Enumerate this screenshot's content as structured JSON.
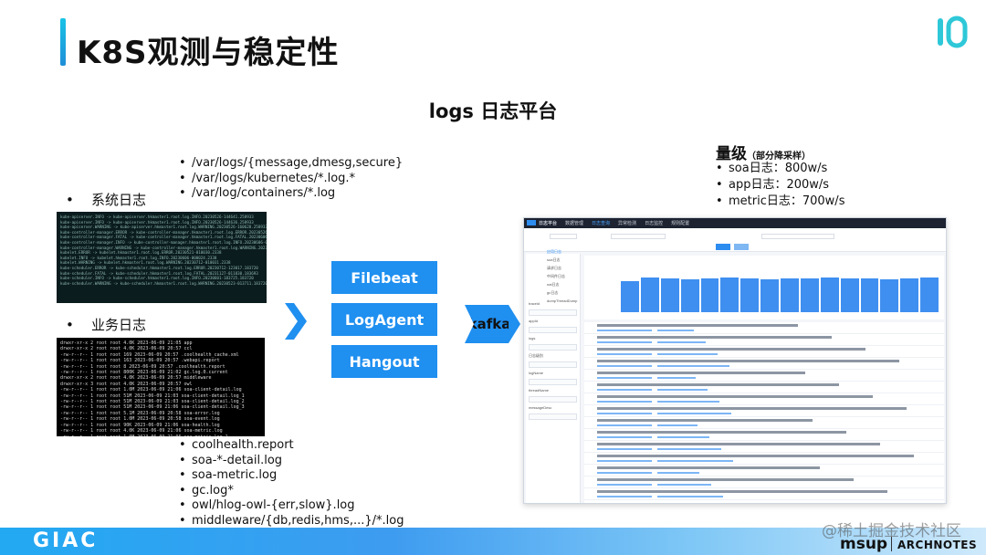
{
  "title": "K8S观测与稳定性",
  "subtitle": "logs 日志平台",
  "system_logs": {
    "heading": "系统日志",
    "paths": [
      "/var/logs/{message,dmesg,secure}",
      "/var/logs/kubernetes/*.log.*",
      "/var/log/containers/*.log"
    ]
  },
  "business_logs": {
    "heading": "业务日志",
    "paths": [
      "coolhealth.report",
      "soa-*-detail.log",
      "soa-metric.log",
      "gc.log*",
      "owl/hlog-owl-{err,slow}.log",
      "middleware/{db,redis,hms,...}/*.log"
    ]
  },
  "agents": [
    "Filebeat",
    "LogAgent",
    "Hangout"
  ],
  "queue": "kafka",
  "volume": {
    "title": "量级",
    "note": "（部分降采样）",
    "items": [
      "soa日志：800w/s",
      "app日志：200w/s",
      "metric日志：700w/s"
    ]
  },
  "platform": {
    "brand": "日志平台",
    "nav": [
      "数据管理",
      "日志查询",
      "异常检测",
      "日志监控",
      "规则配置"
    ],
    "side": [
      "应用日志",
      "soa日志",
      "请求日志",
      "中间件日志",
      "nat日志",
      "gc日志",
      "dumpThreadDump"
    ],
    "fields": [
      "traceid",
      "appId",
      "logs",
      "日志级别",
      "logName",
      "threadName",
      "messageDesc"
    ],
    "chart_values": [
      0.55,
      0.62,
      0.6,
      0.58,
      0.6,
      0.62,
      0.6,
      0.58,
      0.6,
      0.6,
      0.61,
      0.59,
      0.6,
      0.58,
      0.6,
      0.62
    ]
  },
  "footer": {
    "left_logo": "GIAC",
    "right_logo_1": "msup",
    "right_logo_2": "ARCHNOTES",
    "watermark": "@稀土掘金技术社区"
  },
  "colors": {
    "accent": "#1f8ff0",
    "title_bar": "#18c3e6",
    "terminal_bg": "#0b1c1f"
  }
}
